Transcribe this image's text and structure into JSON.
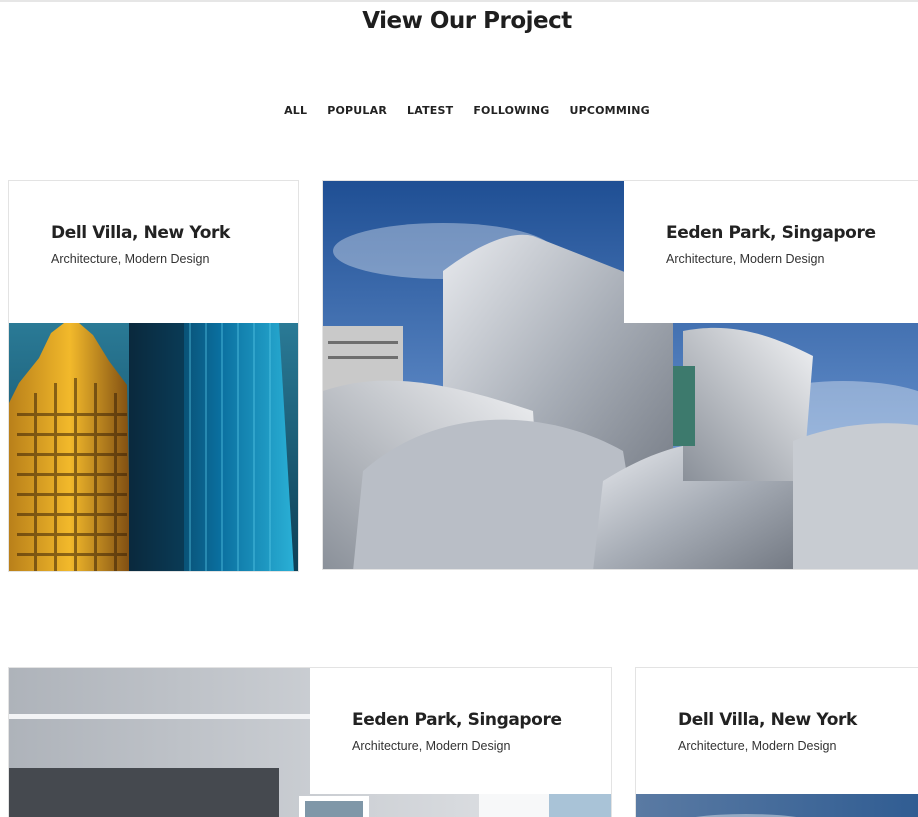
{
  "section": {
    "title": "View Our Project"
  },
  "filters": [
    "ALL",
    "POPULAR",
    "LATEST",
    "FOLLOWING",
    "UPCOMMING"
  ],
  "projects": [
    {
      "title": "Dell Villa, New York",
      "subtitle": "Architecture, Modern Design",
      "image": "skyscrapers-photo"
    },
    {
      "title": "Eeden Park, Singapore",
      "subtitle": "Architecture, Modern Design",
      "image": "curved-steel-building-photo"
    },
    {
      "title": "Eeden Park, Singapore",
      "subtitle": "Architecture, Modern Design",
      "image": "interior-room-photo"
    },
    {
      "title": "Dell Villa, New York",
      "subtitle": "Architecture, Modern Design",
      "image": "sky-photo"
    }
  ]
}
